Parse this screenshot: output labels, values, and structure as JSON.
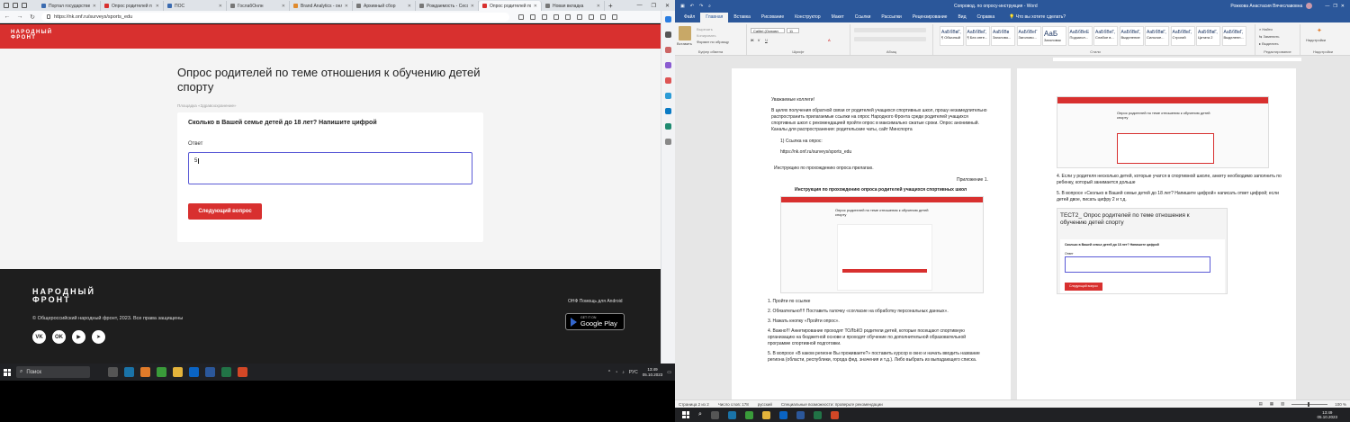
{
  "browser": {
    "tabs": [
      {
        "label": "Портал государствен",
        "color": "#3b6bb0"
      },
      {
        "label": "Опрос родителей п",
        "color": "#d8302f"
      },
      {
        "label": "ПОС",
        "color": "#3b6bb0"
      },
      {
        "label": "ГослабОнлн",
        "color": "#777"
      },
      {
        "label": "Brand Analytics - онл",
        "color": "#e08a2c"
      },
      {
        "label": "Архивный сбор",
        "color": "#777"
      },
      {
        "label": "Рождаемость - Сесс",
        "color": "#777"
      },
      {
        "label": "Опрос родителей по",
        "color": "#d8302f"
      },
      {
        "label": "Новая вкладка",
        "color": "#777"
      }
    ],
    "url": "https://nk.onf.ru/surveys/sports_edu"
  },
  "site": {
    "logo_line1": "НАРОДНЫЙ",
    "logo_line2": "ФРОНТ",
    "survey_title": "Опрос родителей по теме отношения к обучению детей спорту",
    "survey_subtitle": "Площадка «Здравоохранение»",
    "question": "Сколько в Вашей семье детей до 18 лет? Напишите цифрой",
    "answer_label": "Ответ",
    "answer_value": "5",
    "next_button": "Следующий вопрос",
    "footer_logo_line1": "НАРОДНЫЙ",
    "footer_logo_line2": "ФРОНТ",
    "footer_copy": "© Общероссийский народный фронт, 2023. Все права защищены",
    "footer_help": "ОНФ Помощь для Android",
    "gplay_small": "GET IT ON",
    "gplay_big": "Google Play",
    "socials": [
      "VK",
      "OK",
      "▶",
      "➤"
    ]
  },
  "taskbar": {
    "search_placeholder": "Поиск",
    "lang": "РУС",
    "time": "13:49",
    "date": "05.10.2023"
  },
  "word": {
    "title": "Сопровод. по опросу-инструкция - Word",
    "user": "Рожкова Анастасия Вячеславовна",
    "tabs": [
      "Файл",
      "Главная",
      "Вставка",
      "Рисование",
      "Конструктор",
      "Макет",
      "Ссылки",
      "Рассылки",
      "Рецензирование",
      "Вид",
      "Справка"
    ],
    "tell_me": "Что вы хотите сделать?",
    "clipboard": {
      "paste": "Вставить",
      "cut": "Вырезать",
      "copy": "Копировать",
      "format": "Формат по образцу",
      "label": "Буфер обмена"
    },
    "font": {
      "name": "Calibri (Основн",
      "size": "11",
      "label": "Шрифт"
    },
    "paragraph_label": "Абзац",
    "styles_label": "Стили",
    "styles": [
      {
        "sample": "АаБбВвГ,",
        "name": "¶ Обычный"
      },
      {
        "sample": "АаБбВвГ,",
        "name": "¶ Без инте..."
      },
      {
        "sample": "АаБбВв",
        "name": "Заголово..."
      },
      {
        "sample": "АаБбВеГ",
        "name": "Заголово..."
      },
      {
        "sample": "АаБ",
        "name": "Заголовок"
      },
      {
        "sample": "АаБбВеЕ",
        "name": "Подзагол..."
      },
      {
        "sample": "АаБбВеГ,",
        "name": "Слабое в..."
      },
      {
        "sample": "АаБбВвГ,",
        "name": "Выделение"
      },
      {
        "sample": "АаБбВвГ,",
        "name": "Сильное..."
      },
      {
        "sample": "АаБбВвГ,",
        "name": "Строгий"
      },
      {
        "sample": "АаБбВвГ,",
        "name": "Цитата 2"
      },
      {
        "sample": "АаБбВвГ,",
        "name": "Выделенн..."
      }
    ],
    "editing": {
      "find": "Найти",
      "replace": "Заменить",
      "select": "Выделить",
      "label": "Редактирование"
    },
    "addins": {
      "name": "Надстройки",
      "label": "Надстройки"
    },
    "page1": {
      "greeting": "Уважаемые коллеги!",
      "para": "В целях получения обратной связи от родителей учащихся спортивных школ, прошу незамедлительно распространить прилагаемые ссылки на опрос Народного Фронта среди родителей учащихся спортивных школ с рекомендацией пройти опрос в максимально сжатые сроки. Опрос анонимный. Каналы для распространения: родительские чаты, сайт Минспорта",
      "link_item": "1)    Ссылка на опрос:",
      "link": "https://nk.onf.ru/surveys/sports_edu",
      "instr": "Инструкцию по прохождению опроса прилагаю.",
      "appendix": "Приложение 1.",
      "instr_title": "Инструкция по прохождению опроса родителей учащихся спортивных школ",
      "thumb_title": "Опрос родителей по теме отношения к обучению детей спорту",
      "steps": [
        "1.  Пройти по ссылке",
        "2.  Обязательно!!!! Поставить галочку «согласие на обработку персональных данных».",
        "3.  Нажать кнопку «Пройти опрос».",
        "4.  Важно!!! Анкетирование проходят ТОЛЬКО родители детей, которые посещают спортивную организацию на бюджетной основе и проходят обучение по дополнительной образовательной программе спортивной подготовки.",
        "5.  В вопросе «В каком регионе Вы проживаете?» поставить курсор в окно и начать вводить название региона (области, республики, города фед. значения и т.д.). Либо выбрать из выпадающего списка."
      ]
    },
    "page2": {
      "thumb_title": "Опрос родителей по теме отношения к обучению детей спорту",
      "step4": "4. Если у родителя несколько детей, которые учатся в спортивной школе, анкету необходимо заполнить по ребенку, который занимается дольше",
      "step5": "5. В вопросе «Сколько в Вашей семье детей до 18 лет? Напишите цифрой» написать ответ цифрой; если детей двое, писать цифру 2 и т.д.",
      "test_title": "ТЕСТ2_ Опрос родителей по теме отношения к обучению детей спорту",
      "test_question": "Сколько в Вашей семье детей до 18 лет? Напишите цифрой",
      "test_label": "Ответ",
      "test_button": "Следующий вопрос"
    },
    "status": {
      "page": "Страница 2 из 2",
      "words": "Число слов: 178",
      "lang": "русский",
      "access": "Специальные возможности: проверьте рекомендации",
      "zoom": "100 %"
    }
  }
}
